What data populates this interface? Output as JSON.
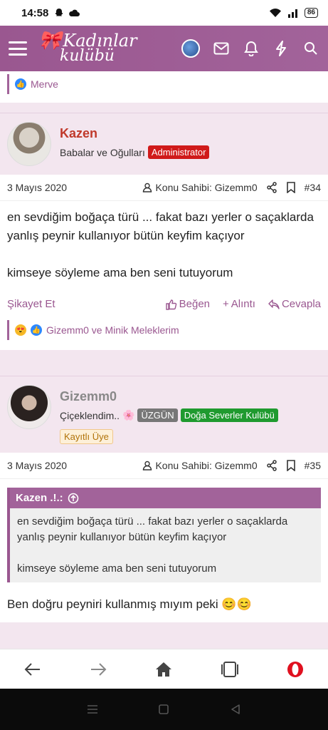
{
  "status": {
    "time": "14:58",
    "battery": "86"
  },
  "header": {
    "logo_line1": "Kadınlar",
    "logo_line2": "kulübü"
  },
  "prev_reaction": {
    "names": "Merve"
  },
  "posts": [
    {
      "author": "Kazen",
      "title": "Babalar ve Oğulları",
      "badges": [
        "Administrator"
      ],
      "date": "3 Mayıs 2020",
      "thread_owner": "Konu Sahibi: Gizemm0",
      "number": "#34",
      "body": [
        "en sevdiğim boğaça türü ... fakat bazı yerler o saçaklarda yanlış peynir kullanıyor bütün keyfim kaçıyor",
        "kimseye söyleme ama ben seni tutuyorum"
      ],
      "actions": {
        "report": "Şikayet Et",
        "like": "Beğen",
        "quote": "Alıntı",
        "reply": "Cevapla"
      },
      "reactions": "Gizemm0 ve Minik Meleklerim"
    },
    {
      "author": "Gizemm0",
      "title": "Çiçeklendim..",
      "title_emoji": "🌸",
      "badges": [
        "ÜZGÜN",
        "Doğa Severler Kulübü",
        "Kayıtlı Üye"
      ],
      "date": "3 Mayıs 2020",
      "thread_owner": "Konu Sahibi: Gizemm0",
      "number": "#35",
      "quote": {
        "author": "Kazen .!.:",
        "body": [
          "en sevdiğim boğaça türü ... fakat bazı yerler o saçaklarda yanlış peynir kullanıyor bütün keyfim kaçıyor",
          "kimseye söyleme ama ben seni tutuyorum"
        ]
      },
      "body": [
        "Ben doğru peyniri kullanmış mıyım peki 😊😊"
      ]
    }
  ],
  "colors": {
    "brand": "#9a5790",
    "admin": "#d01a1a",
    "club": "#1f9a2f"
  },
  "icons": [
    "hamburger-icon",
    "envelope-icon",
    "bell-icon",
    "bolt-icon",
    "search-icon",
    "user-icon",
    "share-icon",
    "bookmark-icon",
    "thumbs-up-icon",
    "plus-icon",
    "reply-icon",
    "arrow-up-circle-icon",
    "back-icon",
    "forward-icon",
    "home-icon",
    "tabs-icon",
    "opera-icon"
  ]
}
